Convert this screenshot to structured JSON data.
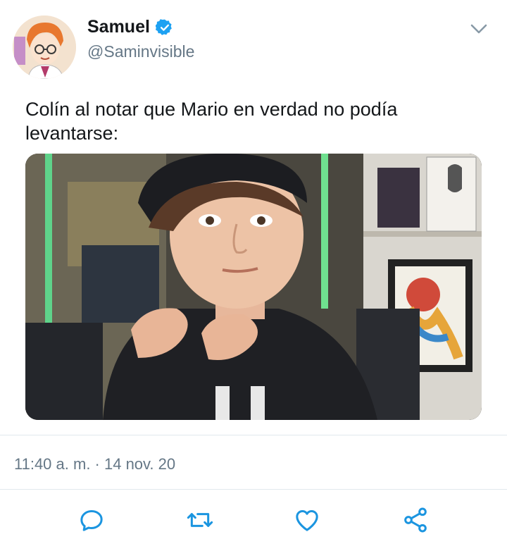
{
  "user": {
    "display_name": "Samuel",
    "handle": "@Saminvisible",
    "verified": true,
    "avatar_icon": "cartoon-avatar"
  },
  "tweet": {
    "text": "Colín al notar que Mario en verdad no podía levantarse:",
    "timestamp": "11:40 a. m. · 14 nov. 20"
  },
  "icons": {
    "more": "chevron-down-icon",
    "reply": "reply-icon",
    "retweet": "retweet-icon",
    "like": "heart-icon",
    "share": "share-icon"
  },
  "colors": {
    "text": "#14171a",
    "secondary": "#657786",
    "verified_blue": "#1da1f2",
    "icon_blue": "#1b95e0",
    "divider": "#e1e8ed"
  }
}
